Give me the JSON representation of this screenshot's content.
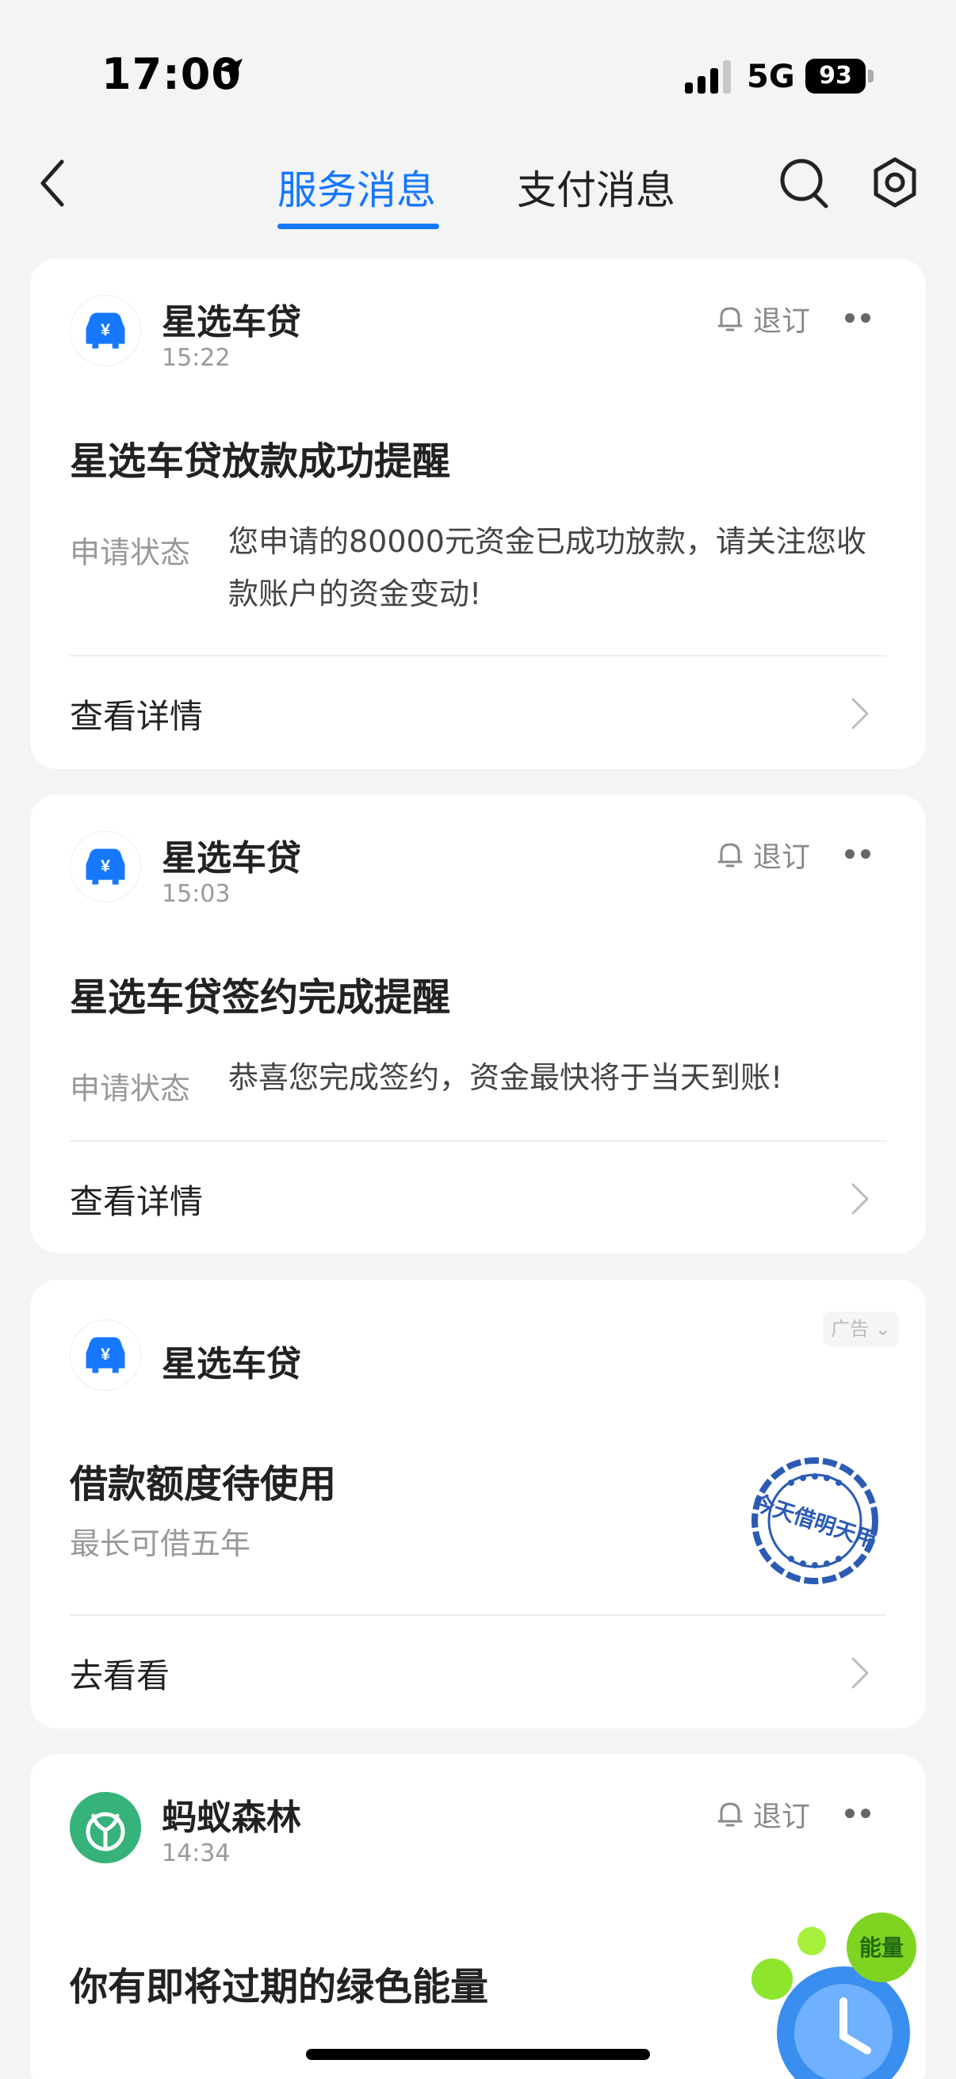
{
  "status_bar": {
    "time": "17:00",
    "network": "5G",
    "battery": "93"
  },
  "header": {
    "tabs": [
      {
        "label": "服务消息",
        "active": true
      },
      {
        "label": "支付消息",
        "active": false
      }
    ]
  },
  "cards": [
    {
      "sender": "星选车贷",
      "time": "15:22",
      "unsubscribe": "退订",
      "title": "星选车贷放款成功提醒",
      "label": "申请状态",
      "content": "您申请的80000元资金已成功放款，请关注您收款账户的资金变动!",
      "action": "查看详情"
    },
    {
      "sender": "星选车贷",
      "time": "15:03",
      "unsubscribe": "退订",
      "title": "星选车贷签约完成提醒",
      "label": "申请状态",
      "content": "恭喜您完成签约，资金最快将于当天到账!",
      "action": "查看详情"
    },
    {
      "sender": "星选车贷",
      "ad_badge": "广告",
      "title": "借款额度待使用",
      "subtitle": "最长可借五年",
      "stamp_text": "今天借明天用",
      "action": "去看看"
    },
    {
      "sender": "蚂蚁森林",
      "time": "14:34",
      "unsubscribe": "退订",
      "title": "你有即将过期的绿色能量",
      "badge_text": "能量"
    }
  ],
  "colors": {
    "accent": "#1677ff",
    "forest_green": "#35b37a",
    "background": "#f3f4f6"
  }
}
